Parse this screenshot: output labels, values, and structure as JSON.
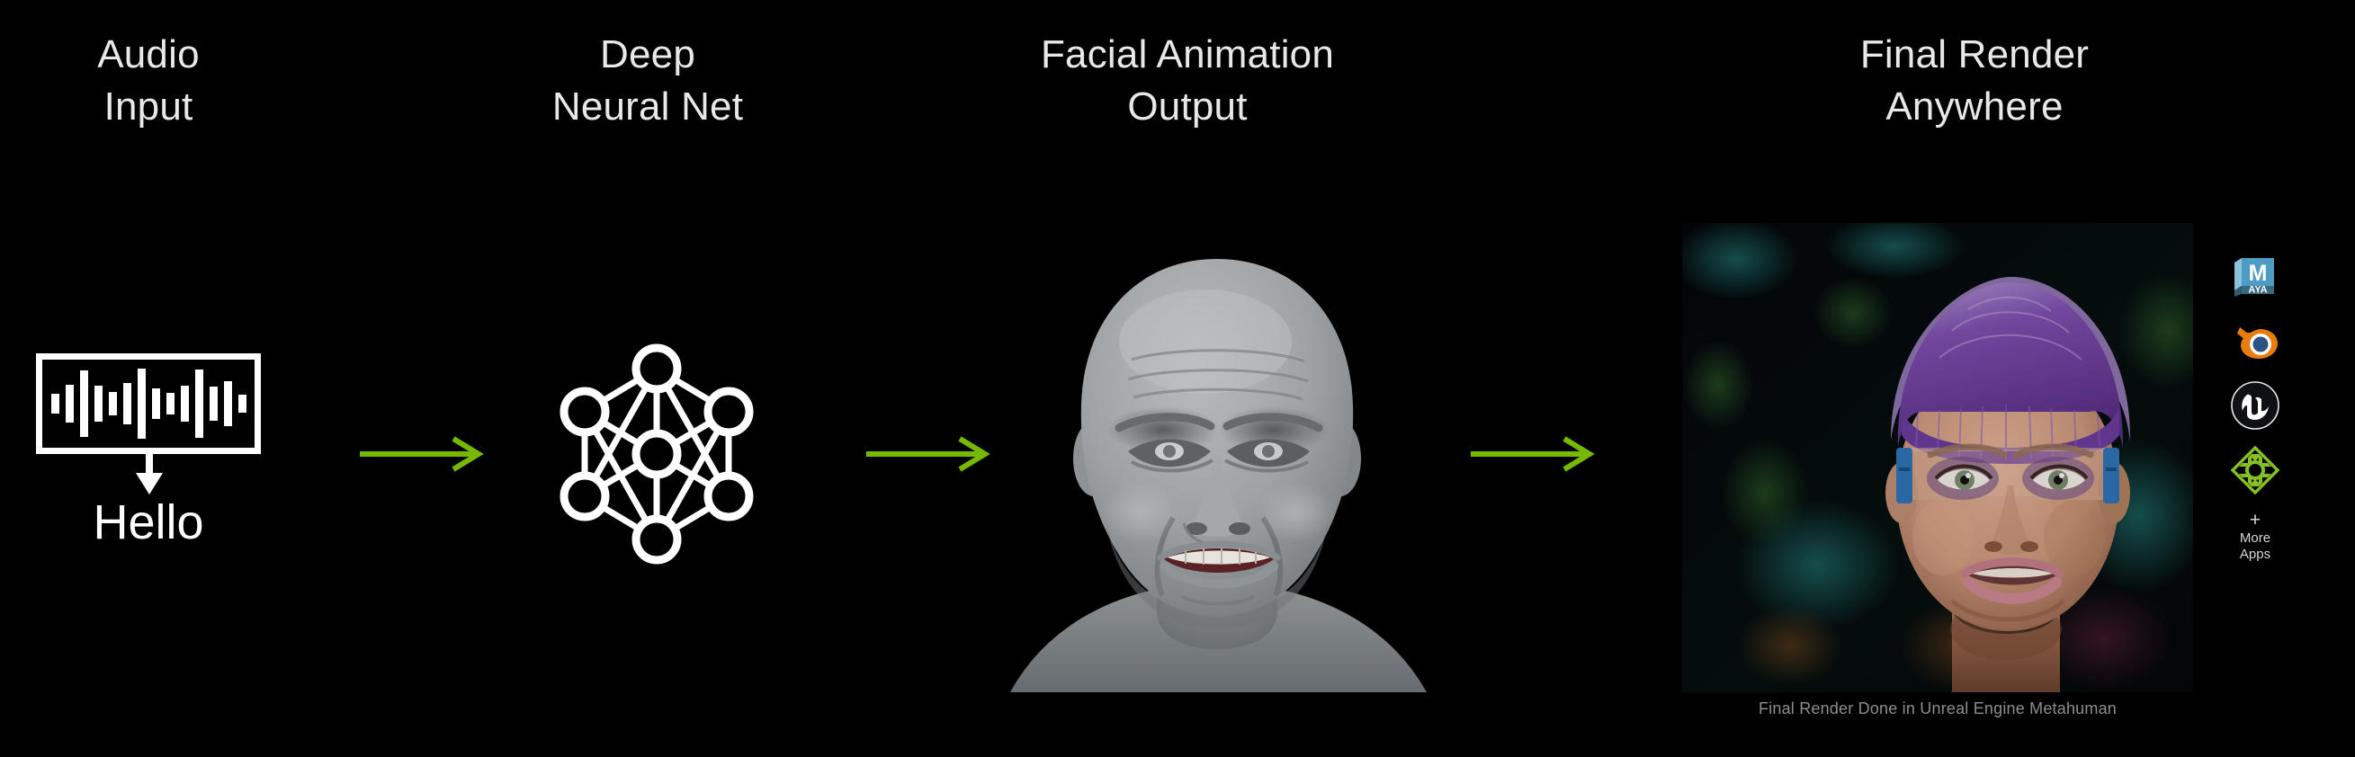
{
  "background": "#000000",
  "accent_green": "#76b900",
  "title_color": "#e8e8e8",
  "columns": [
    {
      "id": "audio",
      "label": "Audio\nInput"
    },
    {
      "id": "dnn",
      "label": "Deep\nNeural Net"
    },
    {
      "id": "facial",
      "label": "Facial Animation\nOutput"
    },
    {
      "id": "final",
      "label": "Final Render\nAnywhere"
    }
  ],
  "stage_audio": {
    "icon_name": "audio-waveform-icon",
    "transcript": "Hello",
    "arrow_name": "downward-arrow-icon",
    "waveform_bar_heights": [
      22,
      42,
      74,
      40,
      26,
      46,
      78,
      34,
      24,
      40,
      76,
      38,
      50,
      20
    ]
  },
  "stage_dnn": {
    "icon_name": "neural-network-icon",
    "node_count": 7
  },
  "stage_facial": {
    "image_name": "grey-3d-head-model"
  },
  "stage_final": {
    "image_name": "metahuman-render",
    "caption": "Final Render Done in Unreal Engine Metahuman"
  },
  "connector_arrows": [
    {
      "name": "flow-arrow-1"
    },
    {
      "name": "flow-arrow-2"
    },
    {
      "name": "flow-arrow-3"
    }
  ],
  "app_rail": {
    "icons": [
      {
        "name": "maya-icon",
        "label": "M",
        "sub": "AYA",
        "color": "#4e9cc4"
      },
      {
        "name": "blender-icon",
        "color": "#e87d0d"
      },
      {
        "name": "unreal-engine-icon",
        "color": "#0e1013"
      },
      {
        "name": "omniverse-icon",
        "color": "#86c023"
      }
    ],
    "more_label_plus": "+",
    "more_label_line1": "More",
    "more_label_line2": "Apps"
  }
}
